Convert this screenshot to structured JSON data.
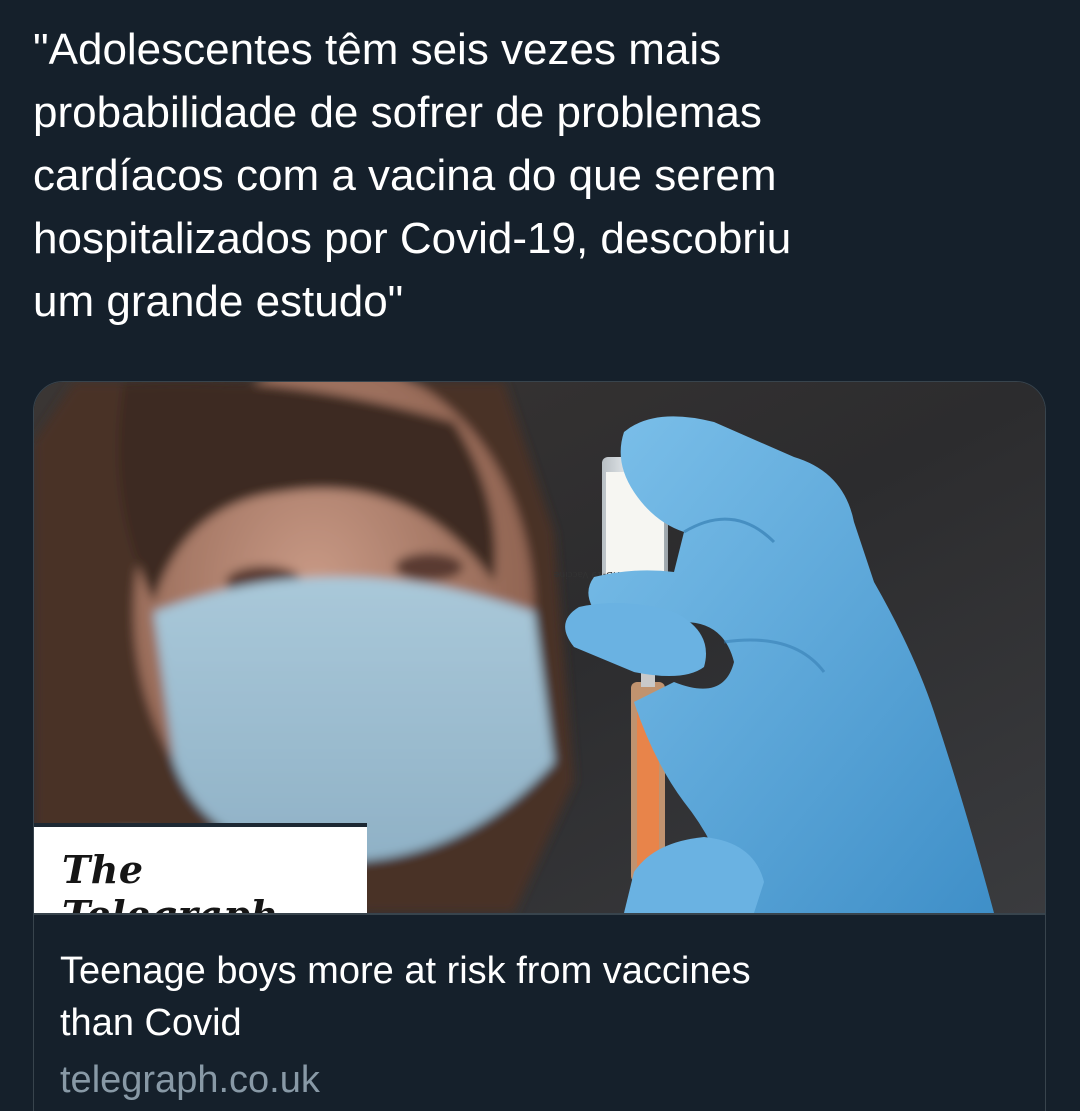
{
  "tweet": {
    "text": "\"Adolescentes têm seis vezes mais\nprobabilidade de sofrer de problemas\ncardíacos com a vacina do que serem\nhospitalizados por Covid-19, descobriu\num grande estudo\""
  },
  "link_card": {
    "publisher_logo": "The Telegraph",
    "title": "Teenage boys more at risk from vaccines\nthan Covid",
    "domain": "telegraph.co.uk",
    "image_icon": "vaccine-photo"
  },
  "colors": {
    "background": "#15202b",
    "text": "#ffffff",
    "secondary_text": "#8899a6",
    "border": "#38444d",
    "glove": "#5aa9dc"
  }
}
